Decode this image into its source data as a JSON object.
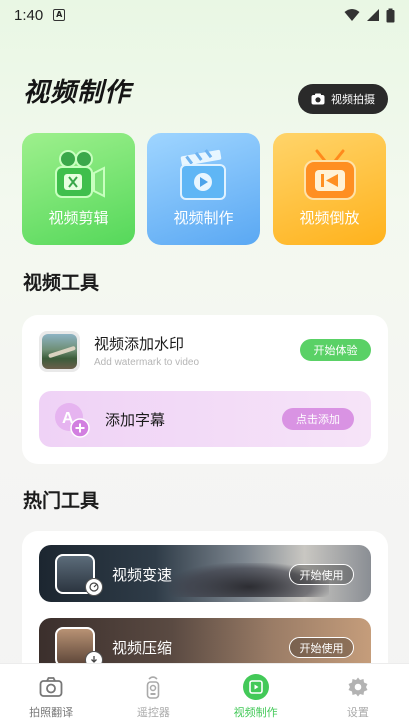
{
  "status_bar": {
    "time": "1:40",
    "notification_badge": "A"
  },
  "header": {
    "title": "视频制作",
    "shoot_button_label": "视频拍摄"
  },
  "feature_cards": [
    {
      "label": "视频剪辑",
      "icon": "camcorder-icon",
      "color": "#55d85a"
    },
    {
      "label": "视频制作",
      "icon": "clapperboard-icon",
      "color": "#5aa8f3"
    },
    {
      "label": "视频倒放",
      "icon": "tv-rewind-icon",
      "color": "#ffb21c"
    }
  ],
  "video_tools": {
    "section_title": "视频工具",
    "watermark": {
      "title": "视频添加水印",
      "subtitle": "Add watermark to video",
      "action": "开始体验"
    },
    "subtitles": {
      "title": "添加字幕",
      "action": "点击添加"
    }
  },
  "hot_tools": {
    "section_title": "热门工具",
    "items": [
      {
        "title": "视频变速",
        "action": "开始使用",
        "badge_icon": "speed-icon"
      },
      {
        "title": "视频压缩",
        "action": "开始使用",
        "badge_icon": "download-icon"
      }
    ]
  },
  "tab_bar": [
    {
      "label": "拍照翻译",
      "icon": "camera-icon",
      "active": false
    },
    {
      "label": "遥控器",
      "icon": "remote-icon",
      "active": false
    },
    {
      "label": "视频制作",
      "icon": "video-icon",
      "active": true
    },
    {
      "label": "设置",
      "icon": "gear-icon",
      "active": false
    }
  ],
  "colors": {
    "accent_green": "#43c958",
    "pill_pink": "#d993e3",
    "dark_button": "#2a2a2a"
  }
}
